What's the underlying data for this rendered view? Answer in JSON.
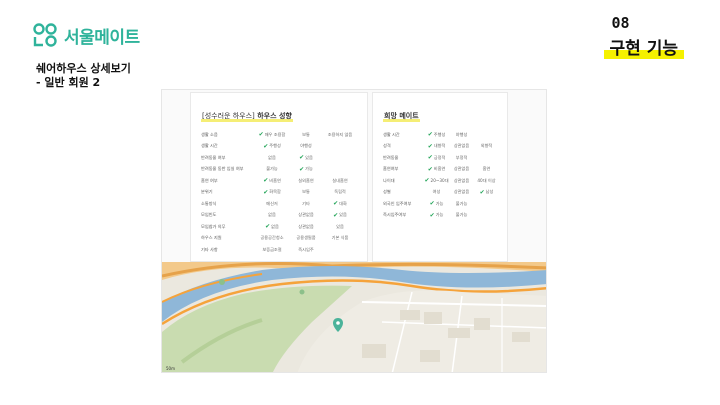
{
  "brand": {
    "name": "서울메이트",
    "color": "#2fb39b"
  },
  "heading": {
    "line1": "쉐어하우스 상세보기",
    "line2": "- 일반 회원 2"
  },
  "slide": {
    "number": "08",
    "title": "구현 기능",
    "highlight": "#f5f100"
  },
  "house_panel": {
    "title_bracket": "[성수러운 하우스]",
    "title_main": " 하우스 성향",
    "rows": [
      {
        "label": "생활 소음",
        "options": [
          "매우 조용함",
          "보통",
          "조용하지 않음"
        ],
        "checked": 0
      },
      {
        "label": "생활 시간",
        "options": [
          "주행성",
          "야행성",
          ""
        ],
        "checked": 0
      },
      {
        "label": "반려동물 여부",
        "options": [
          "없음",
          "있음",
          ""
        ],
        "checked": 1
      },
      {
        "label": "반려동물 동반 입실 여부",
        "options": [
          "불가능",
          "가능",
          ""
        ],
        "checked": 1
      },
      {
        "label": "흡연 여부",
        "options": [
          "비흡연",
          "실외흡연",
          "실내흡연"
        ],
        "checked": 0
      },
      {
        "label": "분위기",
        "options": [
          "화목함",
          "보통",
          "독립적"
        ],
        "checked": 0
      },
      {
        "label": "소통방식",
        "options": [
          "메신저",
          "기타",
          "대화"
        ],
        "checked": 2
      },
      {
        "label": "모임빈도",
        "options": [
          "없음",
          "상관없음",
          "있음"
        ],
        "checked": 2
      },
      {
        "label": "모임참가 의무",
        "options": [
          "없음",
          "상관없음",
          "있음"
        ],
        "checked": 0
      },
      {
        "label": "하우스 지원",
        "options": [
          "공용공간청소",
          "공용생필품",
          "기본 식품"
        ],
        "checked": -1
      },
      {
        "label": "기타 사항",
        "options": [
          "보증금조절",
          "즉시입주",
          ""
        ],
        "checked": -1
      }
    ]
  },
  "mate_panel": {
    "title": "희망 메이트",
    "rows": [
      {
        "label": "생활 시간",
        "options": [
          "주행성",
          "야행성",
          ""
        ],
        "checked": 0
      },
      {
        "label": "성격",
        "options": [
          "내향적",
          "상관없음",
          "외향적"
        ],
        "checked": 0
      },
      {
        "label": "반려동물",
        "options": [
          "긍정적",
          "부정적",
          ""
        ],
        "checked": 0
      },
      {
        "label": "흡연여부",
        "options": [
          "비흡연",
          "상관없음",
          "흡연"
        ],
        "checked": 0
      },
      {
        "label": "나이대",
        "options": [
          "20~30대",
          "상관없음",
          "40대 이상"
        ],
        "checked": 0
      },
      {
        "label": "성별",
        "options": [
          "여성",
          "상관없음",
          "남성"
        ],
        "checked": 2
      },
      {
        "label": "외국인 입주여부",
        "options": [
          "가능",
          "불가능",
          ""
        ],
        "checked": 0
      },
      {
        "label": "즉시입주여부",
        "options": [
          "가능",
          "불가능",
          ""
        ],
        "checked": 0
      }
    ]
  },
  "map": {
    "scale": "50m"
  }
}
